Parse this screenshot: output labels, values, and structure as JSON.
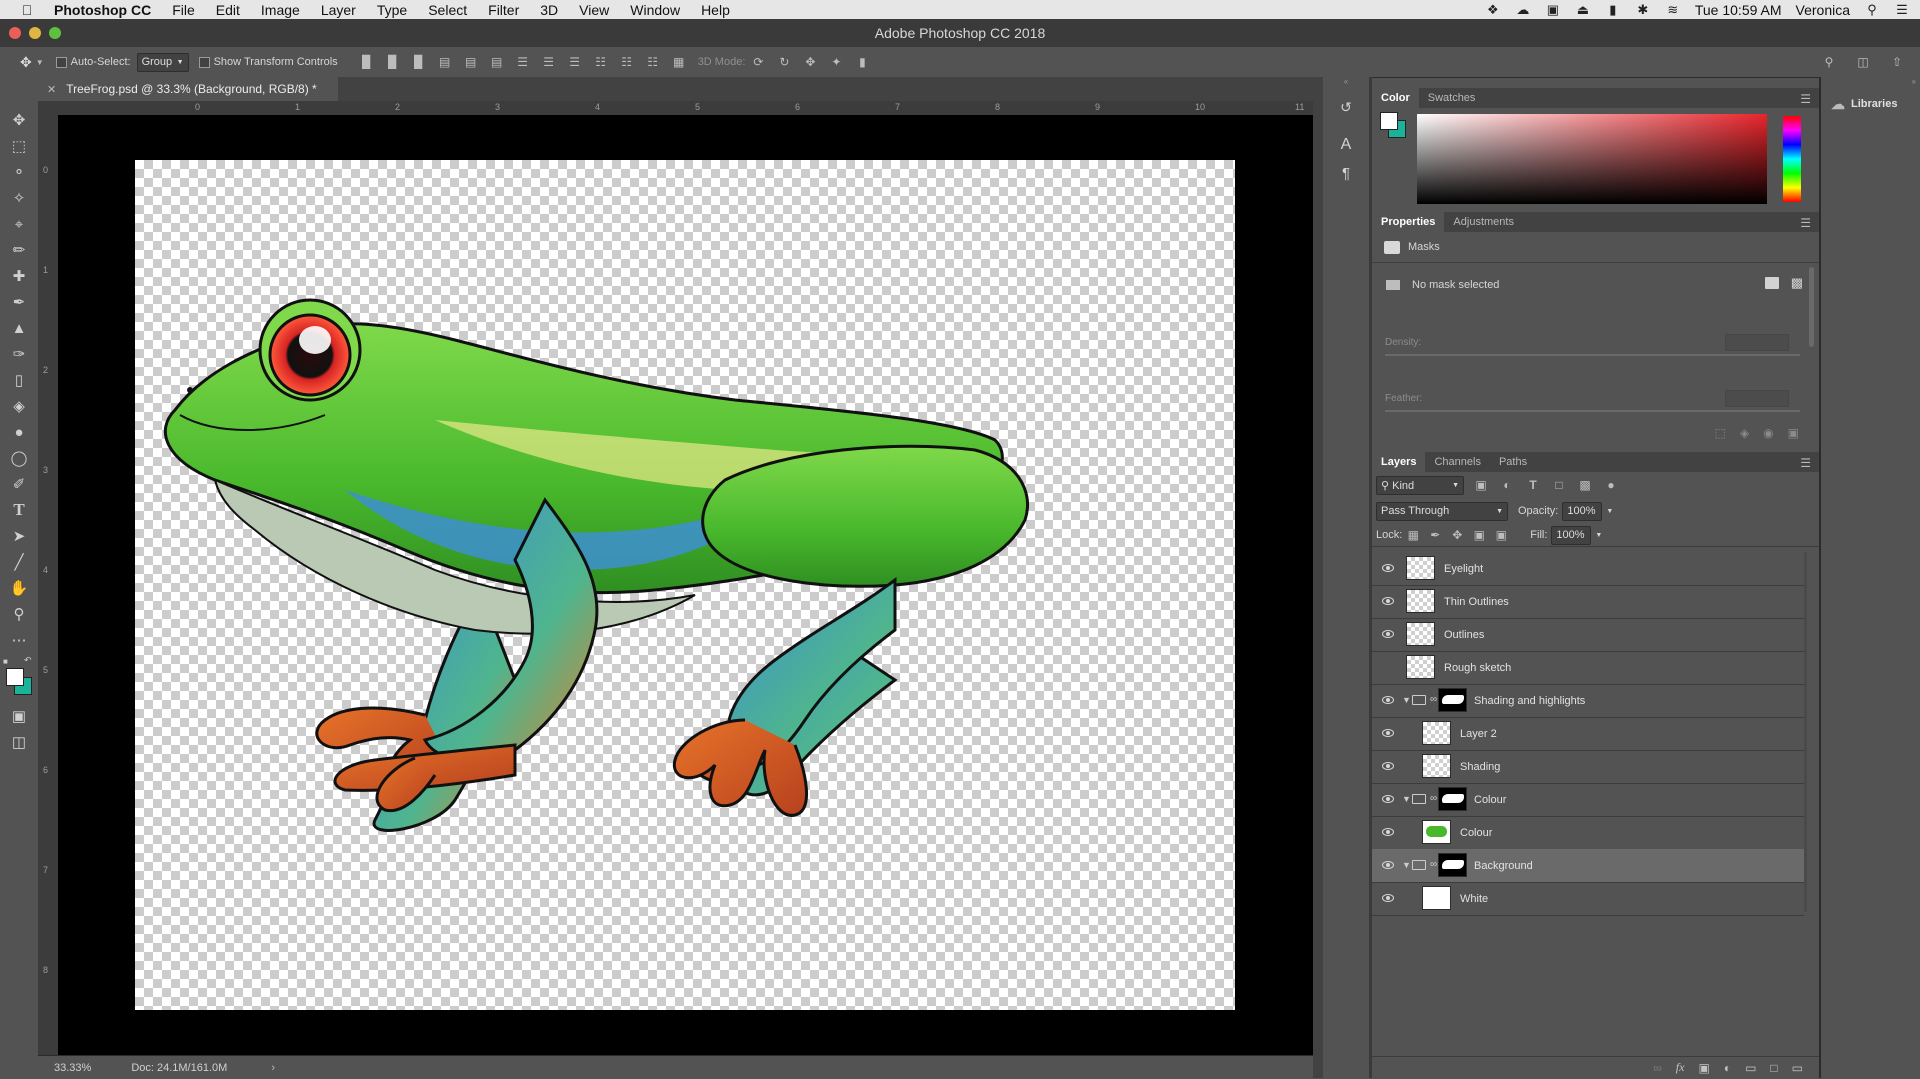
{
  "menubar": {
    "app_name": "Photoshop CC",
    "items": [
      "File",
      "Edit",
      "Image",
      "Layer",
      "Type",
      "Select",
      "Filter",
      "3D",
      "View",
      "Window",
      "Help"
    ],
    "clock": "Tue 10:59 AM",
    "user": "Veronica"
  },
  "window": {
    "title": "Adobe Photoshop CC 2018"
  },
  "options": {
    "auto_select_label": "Auto-Select:",
    "auto_select_value": "Group",
    "transform_label": "Show Transform Controls",
    "mode_3d_label": "3D Mode:"
  },
  "document": {
    "tab_title": "TreeFrog.psd @ 33.3% (Background, RGB/8) *",
    "zoom": "33.33%",
    "doc_size": "Doc: 24.1M/161.0M"
  },
  "rulers": {
    "h_ticks": [
      "0",
      "1",
      "2",
      "3",
      "4",
      "5",
      "6",
      "7",
      "8",
      "9",
      "10",
      "11"
    ],
    "v_ticks": [
      "0",
      "1",
      "2",
      "3",
      "4",
      "5",
      "6",
      "7",
      "8"
    ]
  },
  "color_panel": {
    "tabs": [
      "Color",
      "Swatches"
    ],
    "foreground": "#ffffff",
    "background": "#1ab39a",
    "hue": "#e8252b"
  },
  "properties_panel": {
    "tabs": [
      "Properties",
      "Adjustments"
    ],
    "section": "Masks",
    "status": "No mask selected",
    "density_label": "Density:",
    "feather_label": "Feather:"
  },
  "layers_panel": {
    "tabs": [
      "Layers",
      "Channels",
      "Paths"
    ],
    "filter_value": "Kind",
    "blend_mode": "Pass Through",
    "opacity_label": "Opacity:",
    "opacity_value": "100%",
    "lock_label": "Lock:",
    "fill_label": "Fill:",
    "fill_value": "100%",
    "layers": [
      {
        "name": "Eyelight"
      },
      {
        "name": "Thin Outlines"
      },
      {
        "name": "Outlines"
      },
      {
        "name": "Rough sketch"
      },
      {
        "name": "Shading and highlights"
      },
      {
        "name": "Layer 2"
      },
      {
        "name": "Shading"
      },
      {
        "name": "Colour"
      },
      {
        "name": "Colour"
      },
      {
        "name": "Background"
      },
      {
        "name": "White"
      }
    ]
  },
  "libraries": {
    "label": "Libraries"
  }
}
